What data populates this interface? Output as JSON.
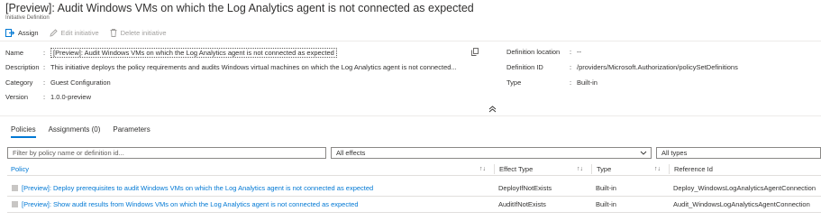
{
  "header": {
    "title": "[Preview]: Audit Windows VMs on which the Log Analytics agent is not connected as expected",
    "subtitle": "Initiative Definition"
  },
  "toolbar": {
    "assign": "Assign",
    "edit": "Edit initiative",
    "delete": "Delete initiative"
  },
  "essentials": {
    "name_label": "Name",
    "name_value": "[Preview]: Audit Windows VMs on which the Log Analytics agent is not connected as expected",
    "description_label": "Description",
    "description_value": "This initiative deploys the policy requirements and audits Windows virtual machines on which the Log Analytics agent is not connected...",
    "category_label": "Category",
    "category_value": "Guest Configuration",
    "version_label": "Version",
    "version_value": "1.0.0-preview",
    "location_label": "Definition location",
    "location_value": "--",
    "defid_label": "Definition ID",
    "defid_value": "/providers/Microsoft.Authorization/policySetDefinitions",
    "type_label": "Type",
    "type_value": "Built-in"
  },
  "tabs": [
    {
      "label": "Policies"
    },
    {
      "label": "Assignments (0)"
    },
    {
      "label": "Parameters"
    }
  ],
  "filters": {
    "search_placeholder": "Filter by policy name or definition id...",
    "effects": "All effects",
    "types": "All types"
  },
  "table": {
    "headers": [
      "Policy",
      "Effect Type",
      "Type",
      "Reference Id"
    ],
    "rows": [
      {
        "policy": "[Preview]: Deploy prerequisites to audit Windows VMs on which the Log Analytics agent is not connected as expected",
        "effect": "DeployIfNotExists",
        "type": "Built-in",
        "ref": "Deploy_WindowsLogAnalyticsAgentConnection"
      },
      {
        "policy": "[Preview]: Show audit results from Windows VMs on which the Log Analytics agent is not connected as expected",
        "effect": "AuditIfNotExists",
        "type": "Built-in",
        "ref": "Audit_WindowsLogAnalyticsAgentConnection"
      }
    ]
  },
  "colors": {
    "accent": "#0078d4",
    "text": "#323130",
    "disabled": "#a19f9d",
    "border": "#8a8886"
  }
}
